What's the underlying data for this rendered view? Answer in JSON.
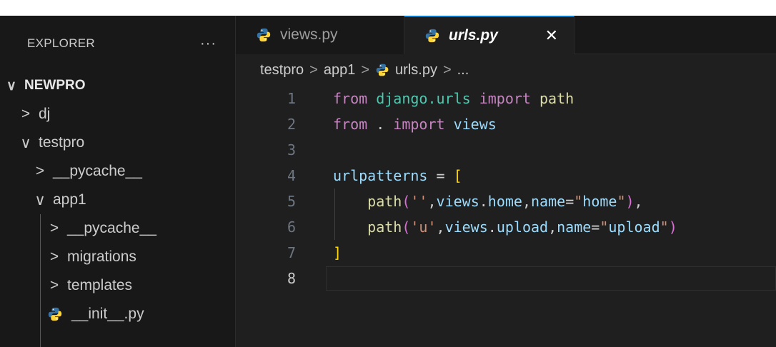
{
  "colors": {
    "accent": "#0078d4",
    "python_blue": "#3572a5",
    "python_yellow": "#ffd43b"
  },
  "explorer": {
    "title": "EXPLORER",
    "more_icon": "ellipsis-icon",
    "more_label": "···",
    "root": {
      "label": "NEWPRO",
      "chevron": "∨"
    },
    "items": [
      {
        "label": "dj",
        "chevron": ">"
      },
      {
        "label": "testpro",
        "chevron": "∨"
      },
      {
        "label": "__pycache__",
        "chevron": ">"
      },
      {
        "label": "app1",
        "chevron": "∨"
      },
      {
        "label": "__pycache__",
        "chevron": ">"
      },
      {
        "label": "migrations",
        "chevron": ">"
      },
      {
        "label": "templates",
        "chevron": ">"
      },
      {
        "label": "__init__.py",
        "icon": "python-icon"
      }
    ]
  },
  "tabs": [
    {
      "label": "views.py",
      "icon": "python-icon"
    },
    {
      "label": "urls.py",
      "icon": "python-icon",
      "active": true,
      "close_label": "✕"
    }
  ],
  "breadcrumb": {
    "parts": [
      "testpro",
      "app1",
      "urls.py",
      "..."
    ],
    "sep": ">"
  },
  "code": {
    "current_line": 8,
    "line_numbers": [
      "1",
      "2",
      "3",
      "4",
      "5",
      "6",
      "7",
      "8"
    ],
    "lines": [
      "from django.urls import path",
      "from . import views",
      "",
      "urlpatterns = [",
      "    path('',views.home,name=\"home\"),",
      "    path('u',views.upload,name=\"upload\")",
      "]",
      ""
    ]
  }
}
